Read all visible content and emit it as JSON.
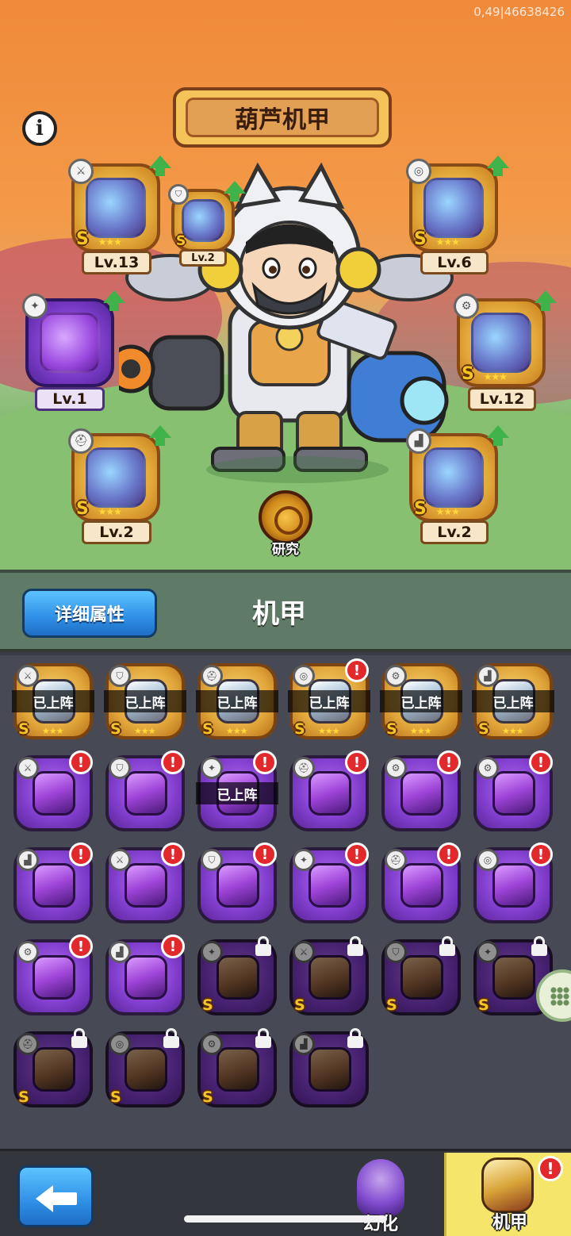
{
  "status": {
    "debug_text": "0,49|46638426"
  },
  "scene": {
    "title": "葫芦机甲",
    "research_label": "研究",
    "equipped": [
      {
        "level": "Lv.13",
        "grade": "S",
        "category_icon": "sword-icon",
        "upgrade": true,
        "rarity": "gold"
      },
      {
        "level": "Lv.2",
        "grade": "S",
        "category_icon": "shield-icon",
        "upgrade": true,
        "rarity": "gold"
      },
      {
        "level": "Lv.6",
        "grade": "S",
        "category_icon": "chest-icon",
        "upgrade": true,
        "rarity": "gold"
      },
      {
        "level": "Lv.1",
        "grade": "",
        "category_icon": "blade-icon",
        "upgrade": true,
        "rarity": "purple"
      },
      {
        "level": "Lv.12",
        "grade": "S",
        "category_icon": "gear-icon",
        "upgrade": true,
        "rarity": "gold"
      },
      {
        "level": "Lv.2",
        "grade": "S",
        "category_icon": "helmet-icon",
        "upgrade": true,
        "rarity": "gold"
      },
      {
        "level": "Lv.2",
        "grade": "S",
        "category_icon": "boot-icon",
        "upgrade": true,
        "rarity": "gold"
      }
    ]
  },
  "header": {
    "detail_button": "详细属性",
    "title": "机甲"
  },
  "inventory": {
    "deployed_label": "已上阵",
    "items": [
      {
        "rarity": "gold",
        "category_icon": "sword-icon",
        "deployed": true,
        "alert": false,
        "locked": false,
        "grade": "S"
      },
      {
        "rarity": "gold",
        "category_icon": "shield-icon",
        "deployed": true,
        "alert": false,
        "locked": false,
        "grade": "S"
      },
      {
        "rarity": "gold",
        "category_icon": "helmet-icon",
        "deployed": true,
        "alert": false,
        "locked": false,
        "grade": "S"
      },
      {
        "rarity": "gold",
        "category_icon": "chest-icon",
        "deployed": true,
        "alert": true,
        "locked": false,
        "grade": "S"
      },
      {
        "rarity": "gold",
        "category_icon": "gear-icon",
        "deployed": true,
        "alert": false,
        "locked": false,
        "grade": "S"
      },
      {
        "rarity": "gold",
        "category_icon": "boot-icon",
        "deployed": true,
        "alert": false,
        "locked": false,
        "grade": "S"
      },
      {
        "rarity": "purple",
        "category_icon": "sword-icon",
        "deployed": false,
        "alert": true,
        "locked": false,
        "grade": ""
      },
      {
        "rarity": "purple",
        "category_icon": "shield-icon",
        "deployed": false,
        "alert": true,
        "locked": false,
        "grade": ""
      },
      {
        "rarity": "purple",
        "category_icon": "blade-icon",
        "deployed": true,
        "alert": true,
        "locked": false,
        "grade": ""
      },
      {
        "rarity": "purple",
        "category_icon": "helmet-icon",
        "deployed": false,
        "alert": true,
        "locked": false,
        "grade": ""
      },
      {
        "rarity": "purple",
        "category_icon": "gear-icon",
        "deployed": false,
        "alert": true,
        "locked": false,
        "grade": ""
      },
      {
        "rarity": "purple",
        "category_icon": "gear-icon",
        "deployed": false,
        "alert": true,
        "locked": false,
        "grade": ""
      },
      {
        "rarity": "purple",
        "category_icon": "boot-icon",
        "deployed": false,
        "alert": true,
        "locked": false,
        "grade": ""
      },
      {
        "rarity": "purple",
        "category_icon": "sword-icon",
        "deployed": false,
        "alert": true,
        "locked": false,
        "grade": ""
      },
      {
        "rarity": "purple",
        "category_icon": "shield-icon",
        "deployed": false,
        "alert": true,
        "locked": false,
        "grade": ""
      },
      {
        "rarity": "purple",
        "category_icon": "blade-icon",
        "deployed": false,
        "alert": true,
        "locked": false,
        "grade": ""
      },
      {
        "rarity": "purple",
        "category_icon": "helmet-icon",
        "deployed": false,
        "alert": true,
        "locked": false,
        "grade": ""
      },
      {
        "rarity": "purple",
        "category_icon": "chest-icon",
        "deployed": false,
        "alert": true,
        "locked": false,
        "grade": ""
      },
      {
        "rarity": "purple",
        "category_icon": "gear-icon",
        "deployed": false,
        "alert": true,
        "locked": false,
        "grade": ""
      },
      {
        "rarity": "purple",
        "category_icon": "boot-icon",
        "deployed": false,
        "alert": true,
        "locked": false,
        "grade": ""
      },
      {
        "rarity": "purple",
        "category_icon": "blade-icon",
        "deployed": false,
        "alert": false,
        "locked": true,
        "grade": "S"
      },
      {
        "rarity": "purple",
        "category_icon": "sword-icon",
        "deployed": false,
        "alert": false,
        "locked": true,
        "grade": "S"
      },
      {
        "rarity": "purple",
        "category_icon": "shield-icon",
        "deployed": false,
        "alert": false,
        "locked": true,
        "grade": "S"
      },
      {
        "rarity": "purple",
        "category_icon": "blade-icon",
        "deployed": false,
        "alert": false,
        "locked": true,
        "grade": "S"
      },
      {
        "rarity": "purple",
        "category_icon": "helmet-icon",
        "deployed": false,
        "alert": false,
        "locked": true,
        "grade": "S"
      },
      {
        "rarity": "purple",
        "category_icon": "chest-icon",
        "deployed": false,
        "alert": false,
        "locked": true,
        "grade": "S"
      },
      {
        "rarity": "purple",
        "category_icon": "gear-icon",
        "deployed": false,
        "alert": false,
        "locked": true,
        "grade": "S"
      },
      {
        "rarity": "purple",
        "category_icon": "boot-icon",
        "deployed": false,
        "alert": false,
        "locked": true,
        "grade": ""
      }
    ]
  },
  "bottom": {
    "tab_morph": "幻化",
    "tab_mecha": "机甲",
    "mecha_alert": "!"
  }
}
